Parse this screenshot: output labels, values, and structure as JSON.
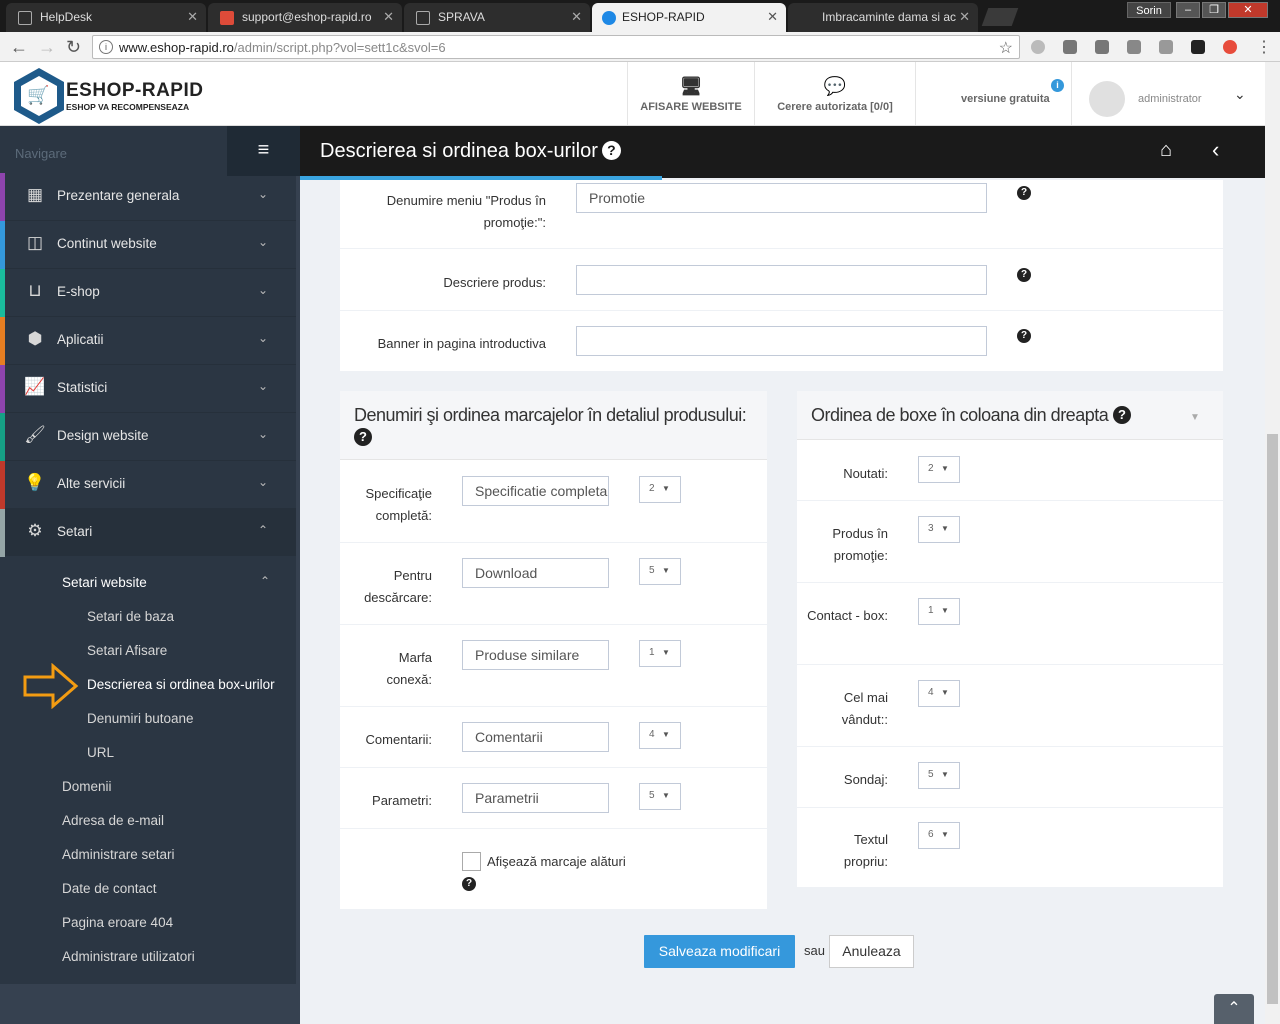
{
  "browser": {
    "tabs": [
      {
        "title": "HelpDesk",
        "color": "#ffffff"
      },
      {
        "title": "support@eshop-rapid.ro",
        "color": "#dd4b39"
      },
      {
        "title": "SPRAVA",
        "color": "#ffffff"
      },
      {
        "title": "ESHOP-RAPID",
        "color": "#1e88e5"
      },
      {
        "title": "Imbracaminte dama si ac",
        "color": "#888888"
      }
    ],
    "user": "Sorin",
    "url_host": "www.eshop-rapid.ro",
    "url_path": "/admin/script.php?vol=sett1c&svol=6"
  },
  "logo": {
    "title": "ESHOP-RAPID",
    "subtitle": "ESHOP VA RECOMPENSEAZA"
  },
  "header": {
    "website_label": "AFISARE WEBSITE",
    "request_label": "Cerere autorizata [0/0]",
    "version_label": "versiune gratuita",
    "user_name": "administrator"
  },
  "sidebar": {
    "nav_label": "Navigare",
    "items": [
      {
        "label": "Prezentare generala",
        "icon": "grid-icon",
        "color": "#8e44ad"
      },
      {
        "label": "Continut website",
        "icon": "columns-icon",
        "color": "#3498db"
      },
      {
        "label": "E-shop",
        "icon": "basket-icon",
        "color": "#1abc9c"
      },
      {
        "label": "Aplicatii",
        "icon": "cubes-icon",
        "color": "#e67e22"
      },
      {
        "label": "Statistici",
        "icon": "chart-icon",
        "color": "#8e44ad"
      },
      {
        "label": "Design website",
        "icon": "brush-icon",
        "color": "#16a085"
      },
      {
        "label": "Alte servicii",
        "icon": "bulb-icon",
        "color": "#c0392b"
      },
      {
        "label": "Setari",
        "icon": "gears-icon",
        "color": "#95a5a6"
      }
    ],
    "sub_header": "Setari website",
    "sub_items": [
      "Setari de baza",
      "Setari Afisare",
      "Descrierea si ordinea box-urilor",
      "Denumiri butoane",
      "URL"
    ],
    "other_items": [
      "Domenii",
      "Adresa de e-mail",
      "Administrare setari",
      "Date de contact",
      "Pagina eroare 404",
      "Administrare utilizatori"
    ]
  },
  "page": {
    "title": "Descrierea si ordinea box-urilor"
  },
  "top_form": {
    "rows": [
      {
        "label": "Denumire meniu \"Produs în promoţie:\":",
        "value": "Promotie"
      },
      {
        "label": "Descriere produs:",
        "value": ""
      },
      {
        "label": "Banner in pagina introductiva",
        "value": ""
      }
    ]
  },
  "left_card": {
    "title": "Denumiri şi ordinea marcajelor în detaliul produsului:",
    "rows": [
      {
        "label": "Specificaţie completă:",
        "placeholder": "Specificatie completa",
        "order": "2"
      },
      {
        "label": "Pentru descărcare:",
        "placeholder": "Download",
        "order": "5"
      },
      {
        "label": "Marfa conexă:",
        "placeholder": "Produse similare",
        "order": "1"
      },
      {
        "label": "Comentarii:",
        "placeholder": "Comentarii",
        "order": "4"
      },
      {
        "label": "Parametri:",
        "placeholder": "Parametrii",
        "order": "5"
      }
    ],
    "checkbox_label": "Afişează marcaje alături"
  },
  "right_card": {
    "title": "Ordinea de boxe în coloana din dreapta",
    "rows": [
      {
        "label": "Noutati:",
        "order": "2"
      },
      {
        "label": "Produs în promoţie:",
        "order": "3"
      },
      {
        "label": "Contact - box:",
        "order": "1"
      },
      {
        "label": "Cel mai vândut::",
        "order": "4"
      },
      {
        "label": "Sondaj:",
        "order": "5"
      },
      {
        "label": "Textul propriu:",
        "order": "6"
      }
    ]
  },
  "actions": {
    "save": "Salveaza modificari",
    "or": "sau",
    "cancel": "Anuleaza"
  }
}
